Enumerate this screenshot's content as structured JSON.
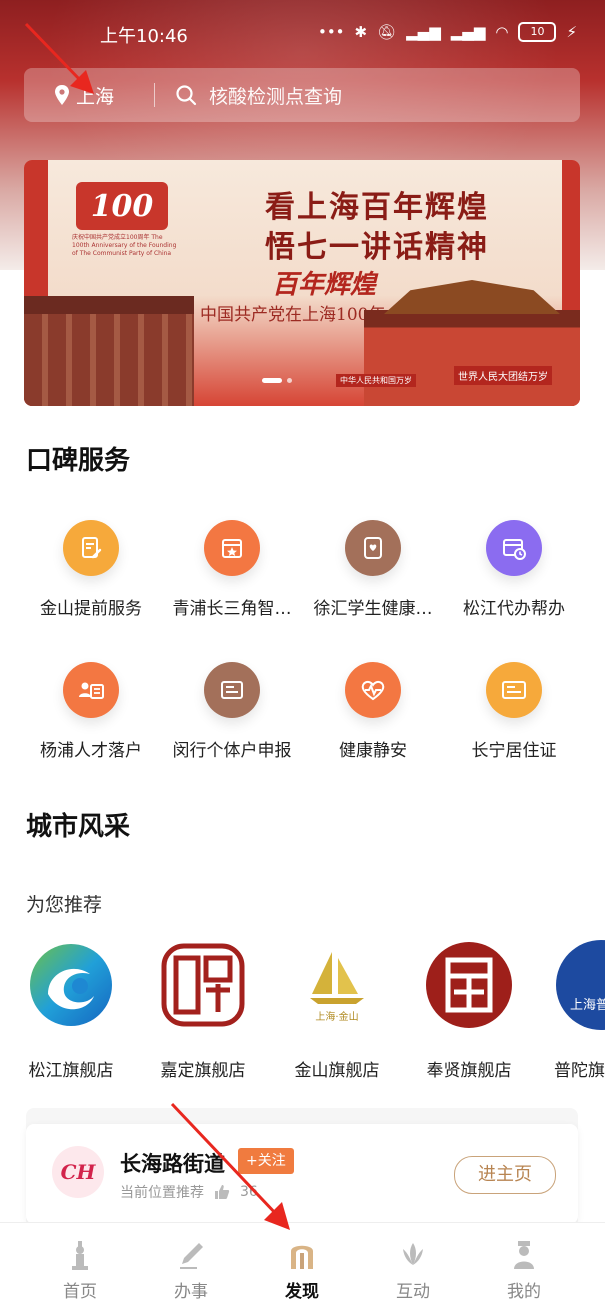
{
  "status_bar": {
    "time": "上午10:46",
    "battery": "10"
  },
  "search": {
    "location": "上海",
    "placeholder": "核酸检测点查询"
  },
  "banner": {
    "logo": "100",
    "logo_sub": "庆祝中国共产党成立100周年 The 100th Anniversary of the Founding of The Communist Party of China",
    "line1": "看上海百年辉煌",
    "line2": "悟七一讲话精神",
    "script": "百年辉煌",
    "subtitle": "中国共产党在上海100年",
    "caption_left": "中华人民共和国万岁",
    "caption_right": "世界人民大团结万岁"
  },
  "services": {
    "title": "口碑服务",
    "items": [
      {
        "label": "金山提前服务",
        "color": "#f6a93b"
      },
      {
        "label": "青浦长三角智…",
        "color": "#f37742"
      },
      {
        "label": "徐汇学生健康…",
        "color": "#a3705a"
      },
      {
        "label": "松江代办帮办",
        "color": "#8b6cf0"
      },
      {
        "label": "杨浦人才落户",
        "color": "#f37742"
      },
      {
        "label": "闵行个体户申报",
        "color": "#a3705a"
      },
      {
        "label": "健康静安",
        "color": "#f37742"
      },
      {
        "label": "长宁居住证",
        "color": "#f6a93b"
      }
    ]
  },
  "city": {
    "title": "城市风采",
    "recommend": "为您推荐",
    "stores": [
      {
        "label": "松江旗舰店"
      },
      {
        "label": "嘉定旗舰店"
      },
      {
        "label": "金山旗舰店",
        "logo_text": "上海·金山"
      },
      {
        "label": "奉贤旗舰店"
      },
      {
        "label": "普陀旗舰店",
        "logo_text": "上海普"
      }
    ]
  },
  "card": {
    "avatar": "CH",
    "name": "长海路街道",
    "follow": "+关注",
    "sub": "当前位置推荐",
    "likes": "36",
    "home_button": "进主页"
  },
  "tabs": [
    {
      "label": "首页"
    },
    {
      "label": "办事"
    },
    {
      "label": "发现",
      "active": true
    },
    {
      "label": "互动"
    },
    {
      "label": "我的"
    }
  ],
  "colors": {
    "accent": "#c8362b",
    "active_tab": "#c9a37a",
    "arrow": "#e8271f"
  }
}
